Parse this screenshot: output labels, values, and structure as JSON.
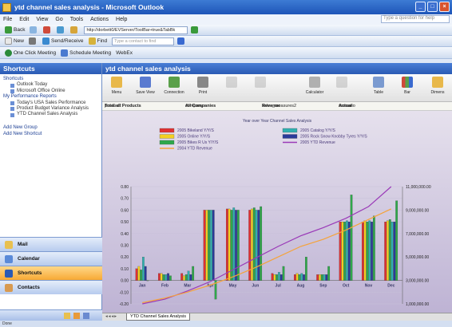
{
  "window": {
    "title": "ytd channel sales analysis - Microsoft Outlook"
  },
  "menu": {
    "items": [
      "File",
      "Edit",
      "View",
      "Go",
      "Tools",
      "Actions",
      "Help"
    ],
    "help_placeholder": "Type a question for help"
  },
  "toolbar1": {
    "back": "Back",
    "address": "http://dorbett0/EVServer/ToolBar+true&TabBk"
  },
  "toolbar2": {
    "new": "New",
    "send_receive": "Send/Receive",
    "find": "Find",
    "contact_placeholder": "Type a contact to find"
  },
  "toolbar3": {
    "one_click": "One Click Meeting",
    "schedule": "Schedule Meeting",
    "webex": "WebEx"
  },
  "shortcuts": {
    "header": "Shortcuts",
    "group1": "Shortcuts",
    "group1_items": [
      "Outlook Today",
      "Microsoft Office Online"
    ],
    "group2": "My Performance Reports",
    "group2_items": [
      "Today's USA Sales Performance",
      "Product Budget Variance Analysis",
      "YTD Channel Sales Analysis"
    ],
    "add_group": "Add New Group",
    "add_shortcut": "Add New Shortcut"
  },
  "nav": {
    "mail": "Mail",
    "calendar": "Calendar",
    "shortcuts": "Shortcuts",
    "contacts": "Contacts"
  },
  "content": {
    "header": "ytd channel sales analysis"
  },
  "ribbon": {
    "menu": "Menu",
    "save_view": "Save View",
    "connection": "Connection",
    "print": "Print",
    "calculator": "Calculator",
    "table": "Table",
    "bar": "Bar",
    "dimension": "Dimens"
  },
  "filters": {
    "product_label": "product :",
    "product_value": "Total all Products",
    "company_label": "company :",
    "company_value": "All Companies",
    "measure_label": "sales_measures2 :",
    "measure_value": "Revenue",
    "scenario_label": "scenario :",
    "scenario_value": "Actual"
  },
  "sheet_tab": "YTD Channel Sales Analysis",
  "status": "Done",
  "chart_data": {
    "type": "bar",
    "title": "Year over Year Channel Sales Analysis",
    "categories": [
      "Jan",
      "Feb",
      "Mar",
      "Apr",
      "May",
      "Jun",
      "Jul",
      "Aug",
      "Sep",
      "Oct",
      "Nov",
      "Dec"
    ],
    "ylim": [
      -0.2,
      0.8
    ],
    "yticks": [
      "0.80",
      "0.70",
      "0.60",
      "0.50",
      "0.40",
      "0.30",
      "0.20",
      "0.10",
      "0.00",
      "-0.10",
      "-0.20"
    ],
    "y2lim": [
      1000000,
      11000000
    ],
    "y2ticks": [
      "11,000,000.00",
      "9,000,000.00",
      "7,000,000.00",
      "5,000,000.00",
      "3,000,000.00",
      "1,000,000.00"
    ],
    "series": [
      {
        "name": "2005 Bikeland Y/Y/S",
        "color": "#e03030",
        "values": [
          0.1,
          0.06,
          0.06,
          0.6,
          0.61,
          0.6,
          0.06,
          0.05,
          0.05,
          0.5,
          0.5,
          0.5
        ]
      },
      {
        "name": "2005 Online Y/Y/S",
        "color": "#f4d020",
        "values": [
          0.12,
          0.06,
          0.04,
          0.6,
          0.61,
          0.61,
          0.05,
          0.06,
          0.05,
          0.5,
          0.51,
          0.51
        ]
      },
      {
        "name": "2005 Bikes R Us Y/Y/S",
        "color": "#2ea84a",
        "values": [
          0.09,
          0.05,
          0.05,
          0.6,
          0.6,
          0.62,
          0.05,
          0.05,
          0.05,
          0.5,
          0.5,
          0.52
        ]
      },
      {
        "name": "2005 Catalog Y/Y/S",
        "color": "#30b0b0",
        "values": [
          0.2,
          0.05,
          0.08,
          0.6,
          0.62,
          0.6,
          0.07,
          0.06,
          0.05,
          0.51,
          0.51,
          0.5
        ]
      },
      {
        "name": "2005 Rock Snow Knobby Tyres Y/Y/S",
        "color": "#2a3a9a",
        "values": [
          0.12,
          0.06,
          0.05,
          0.6,
          0.6,
          0.6,
          0.05,
          0.05,
          0.05,
          0.5,
          0.5,
          0.5
        ]
      },
      {
        "name": "",
        "color": "#2ea84a",
        "values": [
          0.0,
          0.04,
          0.12,
          -0.16,
          0.6,
          0.63,
          0.12,
          0.2,
          0.12,
          0.73,
          0.55,
          0.68
        ]
      }
    ],
    "lines": [
      {
        "name": "2005 YTD Revenue",
        "color": "#9a3ab8",
        "axis": "y2",
        "values": [
          1000000,
          1400000,
          2100000,
          2900000,
          3900000,
          4900000,
          5900000,
          6800000,
          7500000,
          8300000,
          9300000,
          11000000
        ]
      },
      {
        "name": "2004 YTD Revenue",
        "color": "#f5a33a",
        "axis": "y2",
        "values": [
          1100000,
          1500000,
          2000000,
          2600000,
          3300000,
          4100000,
          5000000,
          5900000,
          6500000,
          7300000,
          8200000,
          9100000
        ]
      }
    ],
    "legend_position": "top"
  }
}
